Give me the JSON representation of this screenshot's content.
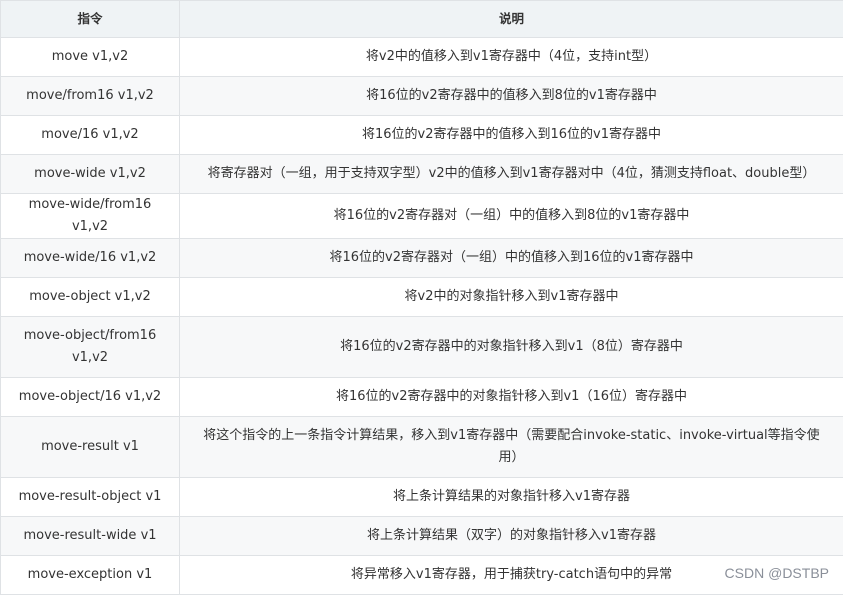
{
  "table": {
    "headers": [
      "指令",
      "说明"
    ],
    "rows": [
      {
        "cmd": "move v1,v2",
        "desc": "将v2中的值移入到v1寄存器中（4位，支持int型）"
      },
      {
        "cmd": "move/from16 v1,v2",
        "desc": "将16位的v2寄存器中的值移入到8位的v1寄存器中"
      },
      {
        "cmd": "move/16 v1,v2",
        "desc": "将16位的v2寄存器中的值移入到16位的v1寄存器中"
      },
      {
        "cmd": "move-wide v1,v2",
        "desc": "将寄存器对（一组，用于支持双字型）v2中的值移入到v1寄存器对中（4位，猜测支持float、double型）"
      },
      {
        "cmd": "move-wide/from16 v1,v2",
        "desc": "将16位的v2寄存器对（一组）中的值移入到8位的v1寄存器中"
      },
      {
        "cmd": "move-wide/16 v1,v2",
        "desc": "将16位的v2寄存器对（一组）中的值移入到16位的v1寄存器中"
      },
      {
        "cmd": "move-object v1,v2",
        "desc": "将v2中的对象指针移入到v1寄存器中"
      },
      {
        "cmd": "move-object/from16 v1,v2",
        "desc": "将16位的v2寄存器中的对象指针移入到v1（8位）寄存器中"
      },
      {
        "cmd": "move-object/16 v1,v2",
        "desc": "将16位的v2寄存器中的对象指针移入到v1（16位）寄存器中"
      },
      {
        "cmd": "move-result v1",
        "desc": "将这个指令的上一条指令计算结果，移入到v1寄存器中（需要配合invoke-static、invoke-virtual等指令使用）"
      },
      {
        "cmd": "move-result-object v1",
        "desc": "将上条计算结果的对象指针移入v1寄存器"
      },
      {
        "cmd": "move-result-wide v1",
        "desc": "将上条计算结果（双字）的对象指针移入v1寄存器"
      },
      {
        "cmd": "move-exception v1",
        "desc": "将异常移入v1寄存器，用于捕获try-catch语句中的异常"
      }
    ]
  },
  "watermark": "CSDN @DSTBP"
}
